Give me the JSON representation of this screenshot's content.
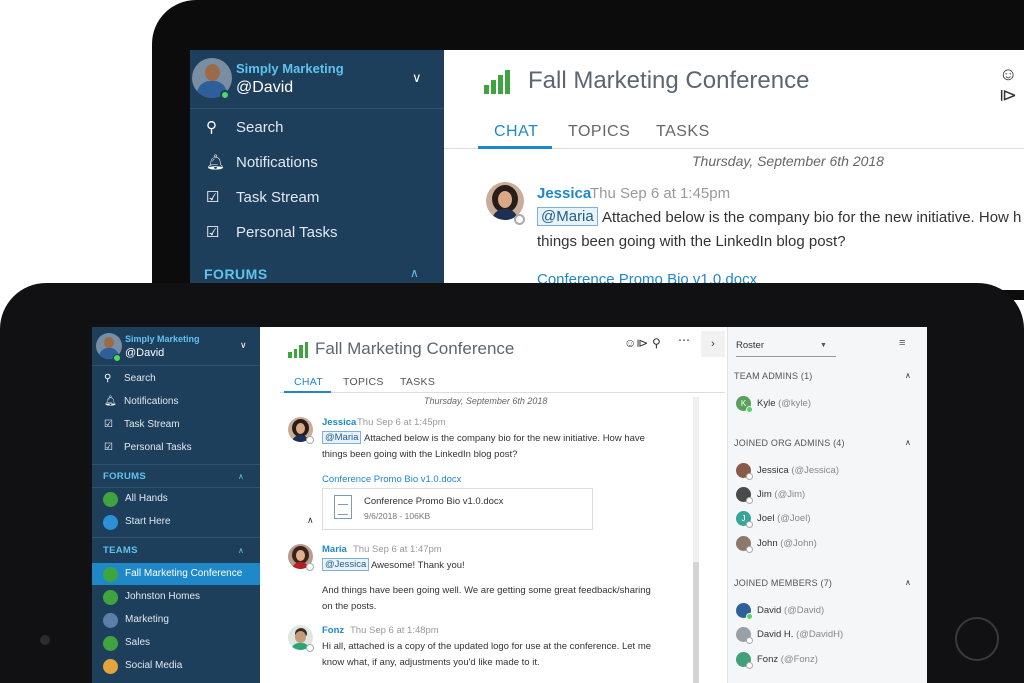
{
  "app": {
    "brand": "Simply Marketing",
    "user": "@David"
  },
  "nav": [
    {
      "label": "Search",
      "icon": "search-icon"
    },
    {
      "label": "Notifications",
      "icon": "bell-icon"
    },
    {
      "label": "Task Stream",
      "icon": "clipboard-check-icon"
    },
    {
      "label": "Personal Tasks",
      "icon": "clipboard-check-icon"
    }
  ],
  "forums": {
    "heading": "FORUMS",
    "items": [
      {
        "label": "All Hands",
        "color": "#3fa43f"
      },
      {
        "label": "Start Here",
        "color": "#2d8fd5"
      }
    ]
  },
  "teams": {
    "heading": "TEAMS",
    "items": [
      {
        "label": "Fall Marketing Conference",
        "color": "#3fa43f",
        "selected": true
      },
      {
        "label": "Johnston Homes",
        "color": "#3fa43f"
      },
      {
        "label": "Marketing",
        "color": "#5b7fa6"
      },
      {
        "label": "Sales",
        "color": "#3fa43f"
      },
      {
        "label": "Social Media",
        "color": "#e3a43c"
      }
    ]
  },
  "conversation": {
    "title": "Fall Marketing Conference",
    "tabs": [
      "CHAT",
      "TOPICS",
      "TASKS"
    ],
    "active_tab": "CHAT",
    "date_divider": "Thursday, September 6th 2018"
  },
  "messages": [
    {
      "author": "Jessica",
      "time": "Thu Sep 6 at 1:45pm",
      "mention": "@Maria",
      "line1": "Attached below is the company bio for the new initiative. How have",
      "line2": "things been going with the LinkedIn blog post?",
      "attachment": {
        "link": "Conference Promo Bio v1.0.docx",
        "name": "Conference Promo Bio v1.0.docx",
        "meta": "9/6/2018 - 106KB"
      }
    },
    {
      "author": "Maria",
      "time": "Thu Sep 6 at 1:47pm",
      "mention": "@Jessica",
      "line1": "Awesome! Thank you!",
      "line2": "And things have been going well. We are getting some great feedback/sharing",
      "line3": "on the posts."
    },
    {
      "author": "Fonz",
      "time": "Thu Sep 6 at 1:48pm",
      "line1": "Hi all, attached is a copy of the updated logo for use at the conference. Let me",
      "line2": "know what, if any, adjustments you'd like made to it."
    }
  ],
  "back_view": {
    "message_line1": "Attached below is the company bio for the new initiative. How h",
    "message_line2": "things been going with the LinkedIn blog post?"
  },
  "roster": {
    "dropdown": "Roster",
    "sections": [
      {
        "title": "TEAM ADMINS (1)",
        "members": [
          {
            "name": "Kyle",
            "handle": "(@kyle)",
            "avatar": "K",
            "color": "#5aa05a"
          }
        ]
      },
      {
        "title": "JOINED ORG ADMINS (4)",
        "members": [
          {
            "name": "Jessica",
            "handle": "(@Jessica)",
            "color": "#8a5a48"
          },
          {
            "name": "Jim",
            "handle": "(@Jim)",
            "color": "#4a4a4a"
          },
          {
            "name": "Joel",
            "handle": "(@Joel)",
            "avatar": "J",
            "color": "#3aa39a"
          },
          {
            "name": "John",
            "handle": "(@John)",
            "color": "#8b7a6a"
          }
        ]
      },
      {
        "title": "JOINED MEMBERS (7)",
        "members": [
          {
            "name": "David",
            "handle": "(@David)",
            "color": "#2f5f9a"
          },
          {
            "name": "David H.",
            "handle": "(@DavidH)",
            "color": "#9aa0a8"
          },
          {
            "name": "Fonz",
            "handle": "(@Fonz)",
            "color": "#3fa07a"
          }
        ]
      }
    ]
  }
}
